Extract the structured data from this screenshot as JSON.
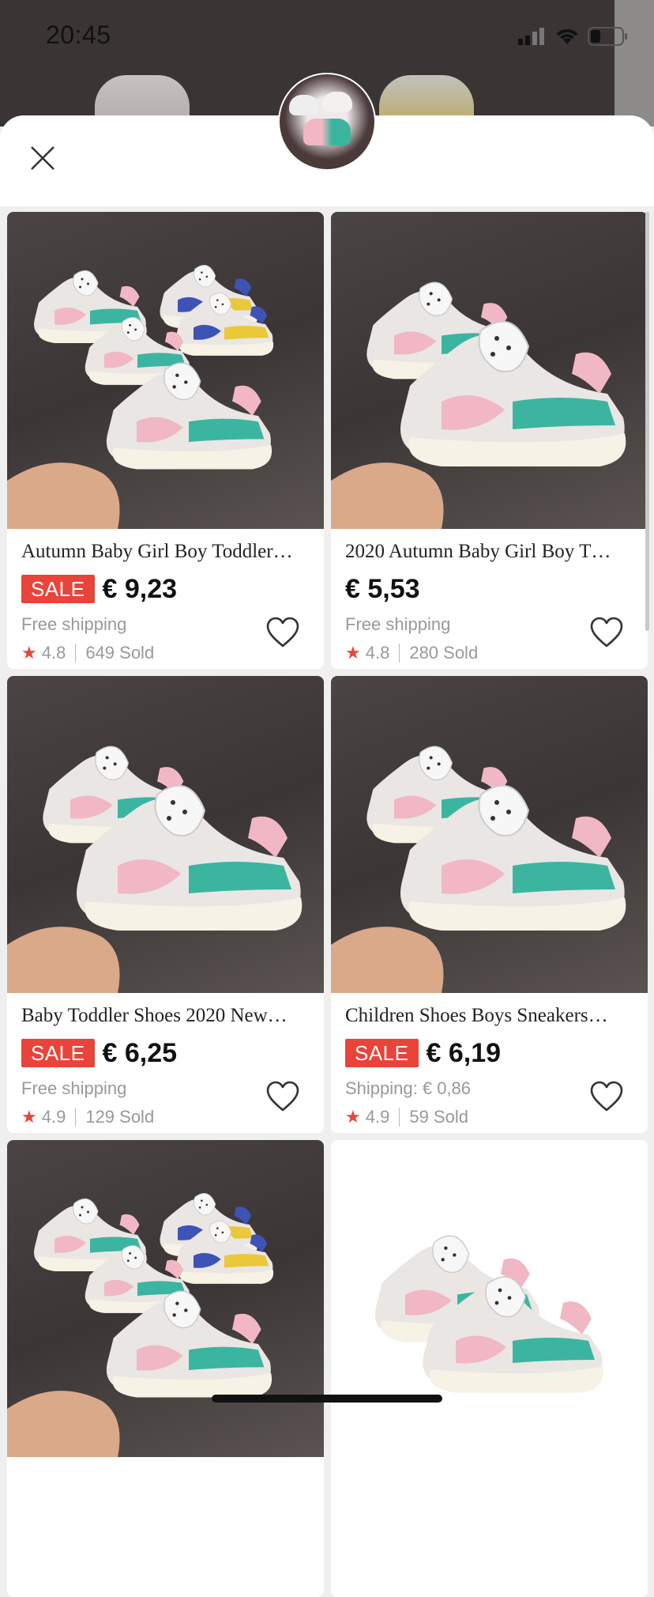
{
  "status_bar": {
    "time": "20:45"
  },
  "products": [
    {
      "title": "Autumn Baby Girl Boy Toddler…",
      "sale_label": "SALE",
      "price": "€ 9,23",
      "shipping": "Free shipping",
      "rating": "4.8",
      "sold": "649 Sold",
      "image": "multi"
    },
    {
      "title": "2020 Autumn Baby Girl Boy T…",
      "sale_label": "",
      "price": "€ 5,53",
      "shipping": "Free shipping",
      "rating": "4.8",
      "sold": "280 Sold",
      "image": "single"
    },
    {
      "title": "Baby Toddler Shoes 2020 New…",
      "sale_label": "SALE",
      "price": "€ 6,25",
      "shipping": "Free shipping",
      "rating": "4.9",
      "sold": "129 Sold",
      "image": "single"
    },
    {
      "title": "Children Shoes Boys Sneakers…",
      "sale_label": "SALE",
      "price": "€ 6,19",
      "shipping": "Shipping: € 0,86",
      "rating": "4.9",
      "sold": "59 Sold",
      "image": "single"
    },
    {
      "title": "",
      "sale_label": "",
      "price": "",
      "shipping": "",
      "rating": "",
      "sold": "",
      "image": "multi"
    },
    {
      "title": "",
      "sale_label": "",
      "price": "",
      "shipping": "",
      "rating": "",
      "sold": "",
      "image": "white"
    }
  ],
  "colors": {
    "sale": "#e8443a",
    "star": "#e8443a",
    "teal": "#3bb5a0",
    "pink": "#f1b7c4"
  },
  "icons": {
    "close": "close-icon",
    "favorite": "heart-icon",
    "rating": "star-icon"
  }
}
